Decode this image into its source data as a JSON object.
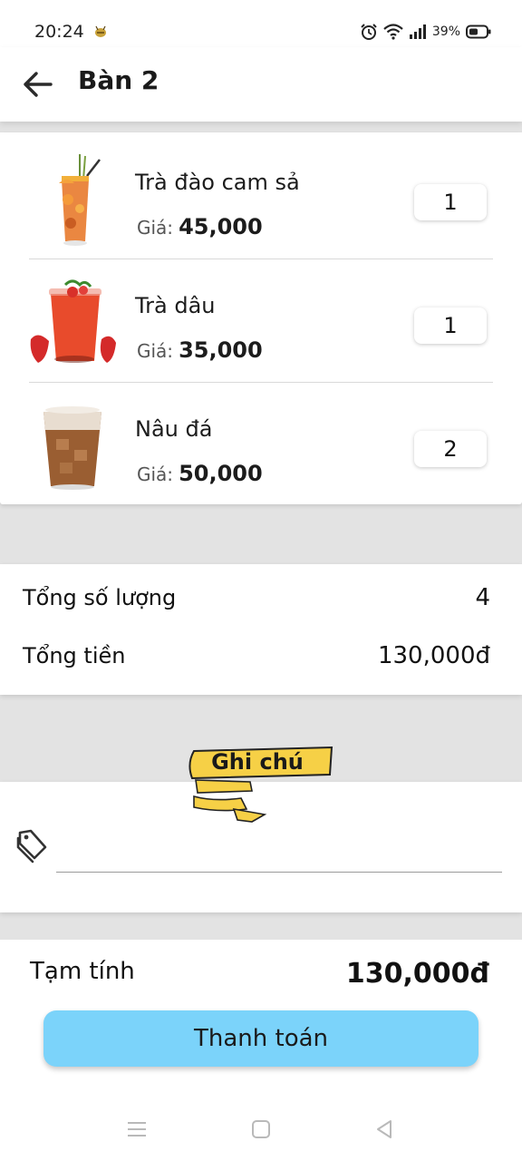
{
  "status_bar": {
    "time": "20:24",
    "battery": "39%",
    "icons": [
      "notification-bee-icon",
      "alarm-icon",
      "wifi-icon",
      "signal-icon",
      "battery-icon"
    ]
  },
  "header": {
    "title": "Bàn 2",
    "back_icon": "back-arrow-icon"
  },
  "order": {
    "price_label": "Giá:",
    "items": [
      {
        "name": "Trà đào cam sả",
        "price": "45,000",
        "quantity": "1",
        "image": "peach-tea-drink"
      },
      {
        "name": "Trà dâu",
        "price": "35,000",
        "quantity": "1",
        "image": "strawberry-tea-drink"
      },
      {
        "name": "Nâu đá",
        "price": "50,000",
        "quantity": "2",
        "image": "iced-milk-coffee-drink"
      }
    ]
  },
  "totals": {
    "quantity_label": "Tổng số lượng",
    "quantity_value": "4",
    "amount_label": "Tổng tiền",
    "amount_value": "130,000đ"
  },
  "note": {
    "ribbon_label": "Ghi chú",
    "input_value": "",
    "icon": "tag-icon"
  },
  "checkout": {
    "subtotal_label": "Tạm tính",
    "subtotal_value": "130,000đ",
    "pay_label": "Thanh toán"
  },
  "system_nav": [
    "menu-icon",
    "home-icon",
    "back-triangle-icon"
  ],
  "colors": {
    "accent_button": "#7bd3fa",
    "ribbon": "#f6d046",
    "background": "#e3e3e3"
  }
}
